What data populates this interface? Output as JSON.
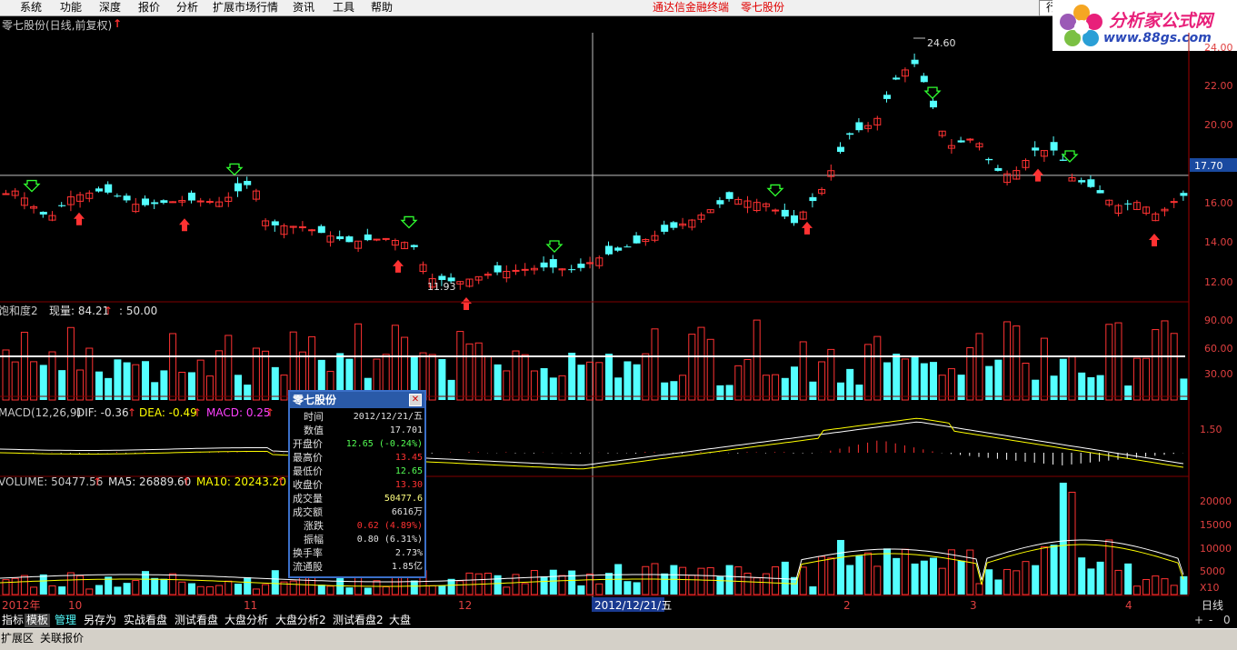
{
  "menu": {
    "items": [
      "系统",
      "功能",
      "深度",
      "报价",
      "分析",
      "扩展市场行情",
      "资讯",
      "工具",
      "帮助"
    ],
    "center_text": "通达信金融终端",
    "center_text2": "零七股份",
    "mini_label": "行"
  },
  "logo": {
    "title": "分析家公式网",
    "url": "www.88gs.com"
  },
  "main_chart": {
    "title": "零七股份(日线,前复权)",
    "high_label": "24.60",
    "low_label": "11.93",
    "crosshair_price": "17.70",
    "y_ticks": [
      "24.00",
      "22.00",
      "20.00",
      "16.00",
      "14.00",
      "12.00"
    ]
  },
  "indicator1": {
    "label": "饱和度2",
    "value_label": "现量: 84.21",
    "value2": ": 50.00",
    "y_ticks": [
      "90.00",
      "60.00",
      "30.00"
    ]
  },
  "macd": {
    "label": "MACD(12,26,9)",
    "dif": "DIF: -0.36",
    "dea": "DEA: -0.49",
    "macd": "MACD: 0.25",
    "y_ticks": [
      "1.50"
    ]
  },
  "volume": {
    "label": "VOLUME: 50477.56",
    "ma5": "MA5: 26889.60",
    "ma10": "MA10: 20243.20",
    "y_ticks": [
      "20000",
      "15000",
      "10000",
      "5000",
      "X10"
    ]
  },
  "date_axis": {
    "labels": [
      "2012年",
      "10",
      "11",
      "12",
      "2012/12/21/五",
      "2",
      "3",
      "4"
    ],
    "period": "日线"
  },
  "popup": {
    "title": "零七股份",
    "rows": [
      {
        "label": "时间",
        "value": "2012/12/21/五"
      },
      {
        "label": "数值",
        "value": "17.701"
      },
      {
        "label": "开盘价",
        "value": "12.65 (-0.24%)"
      },
      {
        "label": "最高价",
        "value": "13.45"
      },
      {
        "label": "最低价",
        "value": "12.65"
      },
      {
        "label": "收盘价",
        "value": "13.30"
      },
      {
        "label": "成交量",
        "value": "50477.6"
      },
      {
        "label": "成交额",
        "value": "6616万"
      },
      {
        "label": "涨跌",
        "value": "0.62 (4.89%)"
      },
      {
        "label": "振幅",
        "value": "0.80 (6.31%)"
      },
      {
        "label": "换手率",
        "value": "2.73%"
      },
      {
        "label": "流通股",
        "value": "1.85亿"
      }
    ]
  },
  "tabs": [
    "指标",
    "模板",
    "管理",
    "另存为",
    "实战看盘",
    "测试看盘",
    "大盘分析",
    "大盘分析2",
    "测试看盘2",
    "大盘"
  ],
  "status": {
    "area1": "扩展区",
    "area2": "关联报价"
  },
  "scroll": {
    "plus": "+",
    "minus": "-",
    "zero": "0"
  },
  "colors": {
    "up": "#ff3232",
    "down": "#54ffff",
    "ma5": "#ffffff",
    "ma10": "#ffff00",
    "accent_blue": "#2a5aa8"
  }
}
